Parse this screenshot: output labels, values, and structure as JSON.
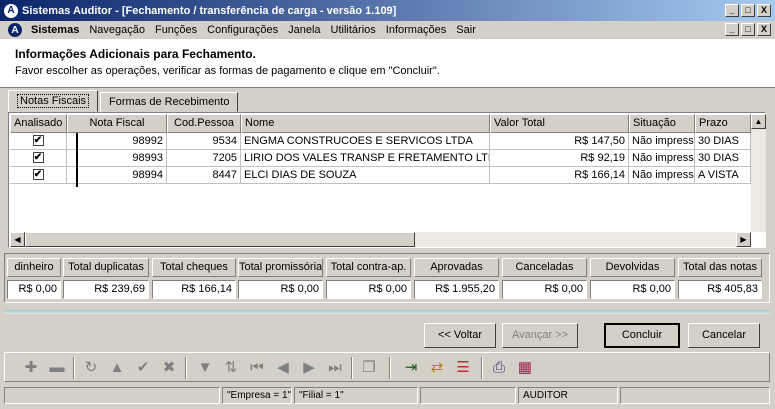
{
  "window": {
    "title": "Sistemas Auditor - [Fechamento / transferência de carga - versão 1.109]",
    "btn_min": "_",
    "btn_max": "□",
    "btn_close": "X"
  },
  "menu": {
    "items": [
      "Sistemas",
      "Navegação",
      "Funções",
      "Configurações",
      "Janela",
      "Utilitários",
      "Informações",
      "Sair"
    ]
  },
  "info": {
    "title": "Informações Adicionais para Fechamento.",
    "subtitle": "Favor escolher as operações, verificar as formas de pagamento e clique em \"Concluir\"."
  },
  "tabs": [
    "Notas Fiscais",
    "Formas de Recebimento"
  ],
  "grid": {
    "columns": [
      "Analisado",
      "Nota Fiscal",
      "Cod.Pessoa",
      "Nome",
      "Valor Total",
      "Situação",
      "Prazo"
    ],
    "rows": [
      {
        "check": "✔",
        "nota": "98992",
        "cod": "9534",
        "nome": "ENGMA CONSTRUCOES E SERVICOS LTDA",
        "valor": "R$ 147,50",
        "situacao": "Não impressa",
        "prazo": "30 DIAS"
      },
      {
        "check": "✔",
        "nota": "98993",
        "cod": "7205",
        "nome": "LIRIO DOS VALES TRANSP E FRETAMENTO LTD",
        "valor": "R$ 92,19",
        "situacao": "Não impressa",
        "prazo": "30 DIAS"
      },
      {
        "check": "✔",
        "nota": "98994",
        "cod": "8447",
        "nome": "ELCI DIAS DE SOUZA",
        "valor": "R$ 166,14",
        "situacao": "Não impressa",
        "prazo": "A VISTA"
      }
    ]
  },
  "totals": [
    {
      "label": "dinheiro",
      "value": "R$ 0,00"
    },
    {
      "label": "Total duplicatas",
      "value": "R$ 239,69"
    },
    {
      "label": "Total cheques",
      "value": "R$ 166,14"
    },
    {
      "label": "Total promissória",
      "value": "R$ 0,00"
    },
    {
      "label": "Total contra-ap.",
      "value": "R$ 0,00"
    },
    {
      "label": "Aprovadas",
      "value": "R$ 1.955,20"
    },
    {
      "label": "Canceladas",
      "value": "R$ 0,00"
    },
    {
      "label": "Devolvidas",
      "value": "R$ 0,00"
    },
    {
      "label": "Total das notas",
      "value": "R$ 405,83"
    }
  ],
  "buttons": {
    "back": "<< Voltar",
    "next": "Avançar >>",
    "finish": "Concluir",
    "cancel": "Cancelar"
  },
  "toolbar_icons": [
    "add-icon",
    "remove-icon",
    "refresh-icon",
    "up-icon",
    "confirm-icon",
    "delete-icon",
    "filter-icon",
    "sort-icon",
    "first-icon",
    "prev-icon",
    "next-icon",
    "last-icon",
    "copy-icon",
    "export-icon",
    "transfer-icon",
    "list-icon",
    "print-icon",
    "report-icon"
  ],
  "status": {
    "empresa": "\"Empresa = 1\"",
    "filial": "\"Filial = 1\"",
    "user": "AUDITOR"
  }
}
